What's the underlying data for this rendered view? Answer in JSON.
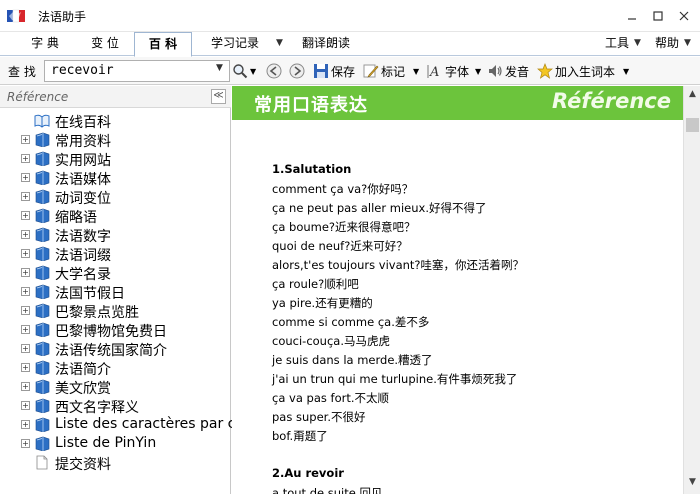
{
  "window": {
    "title": "法语助手",
    "minimize": "▁",
    "maximize": "☐",
    "close": "✕"
  },
  "tabs": [
    {
      "label": "字 典"
    },
    {
      "label": "变 位"
    },
    {
      "label": "百 科",
      "active": true
    },
    {
      "label": "学习记录"
    },
    {
      "label": "翻译朗读"
    }
  ],
  "menu_right": {
    "tools": "工具",
    "help": "帮助"
  },
  "toolbar": {
    "find_label": "查 找",
    "search_value": "recevoir",
    "save": "保存",
    "mark": "标记",
    "font": "字体",
    "speak": "发音",
    "add_word": "加入生词本"
  },
  "left_panel": {
    "title": "Référence",
    "collapse": "≪",
    "items": [
      {
        "label": "在线百科",
        "expandable": false,
        "icon": "open-book-icon"
      },
      {
        "label": "常用资料",
        "expandable": true,
        "icon": "book-icon"
      },
      {
        "label": "实用网站",
        "expandable": true,
        "icon": "book-icon"
      },
      {
        "label": "法语媒体",
        "expandable": true,
        "icon": "book-icon"
      },
      {
        "label": "动词变位",
        "expandable": true,
        "icon": "book-icon"
      },
      {
        "label": "缩略语",
        "expandable": true,
        "icon": "book-icon"
      },
      {
        "label": "法语数字",
        "expandable": true,
        "icon": "book-icon"
      },
      {
        "label": "法语词缀",
        "expandable": true,
        "icon": "book-icon"
      },
      {
        "label": "大学名录",
        "expandable": true,
        "icon": "book-icon"
      },
      {
        "label": "法国节假日",
        "expandable": true,
        "icon": "book-icon"
      },
      {
        "label": "巴黎景点览胜",
        "expandable": true,
        "icon": "book-icon"
      },
      {
        "label": "巴黎博物馆免费日",
        "expandable": true,
        "icon": "book-icon"
      },
      {
        "label": "法语传统国家简介",
        "expandable": true,
        "icon": "book-icon"
      },
      {
        "label": "法语简介",
        "expandable": true,
        "icon": "book-icon"
      },
      {
        "label": "美文欣赏",
        "expandable": true,
        "icon": "book-icon"
      },
      {
        "label": "西文名字释义",
        "expandable": true,
        "icon": "book-icon"
      },
      {
        "label": "Liste des caractères par clé",
        "expandable": true,
        "icon": "book-icon"
      },
      {
        "label": "Liste de PinYin",
        "expandable": true,
        "icon": "book-icon"
      },
      {
        "label": "提交资料",
        "expandable": false,
        "icon": "page-icon"
      }
    ]
  },
  "content": {
    "header_title": "常用口语表达",
    "header_ref": "Référence",
    "lines": [
      {
        "text": "1.Salutation",
        "heading": true
      },
      {
        "text": "comment ça va?你好吗？"
      },
      {
        "text": "ça ne peut pas aller mieux.好得不得了"
      },
      {
        "text": "ça boume?近来很得意吧？"
      },
      {
        "text": "quoi de neuf?近来可好？"
      },
      {
        "text": "alors,t'es toujours vivant?哇塞，你还活着咧？"
      },
      {
        "text": "ça roule?顺利吧"
      },
      {
        "text": "ya pire.还有更糟的"
      },
      {
        "text": "comme si comme ça.差不多"
      },
      {
        "text": "couci-couça.马马虎虎"
      },
      {
        "text": "je suis dans la merde.糟透了"
      },
      {
        "text": "j'ai un trun qui me turlupine.有件事烦死我了"
      },
      {
        "text": "ça va pas fort.不太顺"
      },
      {
        "text": "pas super.不很好"
      },
      {
        "text": "bof.甭题了"
      },
      {
        "text": "2.Au revoir",
        "heading": true
      },
      {
        "text": "a tout de suite.回见"
      }
    ]
  },
  "colors": {
    "header_green": "#6cc43c",
    "book_blue": "#2c6fc4"
  }
}
